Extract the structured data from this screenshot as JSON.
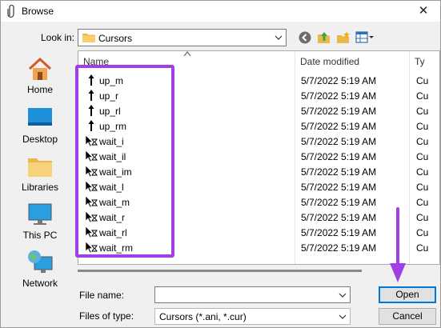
{
  "window": {
    "title": "Browse",
    "close_glyph": "✕"
  },
  "look_in": {
    "label": "Look in:",
    "value": "Cursors"
  },
  "places": [
    {
      "label": "Home",
      "icon": "home-icon"
    },
    {
      "label": "Desktop",
      "icon": "desktop-icon"
    },
    {
      "label": "Libraries",
      "icon": "libraries-folder-icon"
    },
    {
      "label": "This PC",
      "icon": "monitor-icon"
    },
    {
      "label": "Network",
      "icon": "network-icon"
    }
  ],
  "columns": {
    "name": "Name",
    "date": "Date modified",
    "type": "Ty"
  },
  "files": [
    {
      "name": "up_m",
      "date": "5/7/2022 5:19 AM",
      "type": "Cu",
      "icon": "up-arrow-cursor-icon"
    },
    {
      "name": "up_r",
      "date": "5/7/2022 5:19 AM",
      "type": "Cu",
      "icon": "up-arrow-cursor-icon"
    },
    {
      "name": "up_rl",
      "date": "5/7/2022 5:19 AM",
      "type": "Cu",
      "icon": "up-arrow-cursor-icon"
    },
    {
      "name": "up_rm",
      "date": "5/7/2022 5:19 AM",
      "type": "Cu",
      "icon": "up-arrow-cursor-icon"
    },
    {
      "name": "wait_i",
      "date": "5/7/2022 5:19 AM",
      "type": "Cu",
      "icon": "busy-pointer-cursor-icon"
    },
    {
      "name": "wait_il",
      "date": "5/7/2022 5:19 AM",
      "type": "Cu",
      "icon": "busy-pointer-cursor-icon"
    },
    {
      "name": "wait_im",
      "date": "5/7/2022 5:19 AM",
      "type": "Cu",
      "icon": "busy-pointer-cursor-icon"
    },
    {
      "name": "wait_l",
      "date": "5/7/2022 5:19 AM",
      "type": "Cu",
      "icon": "busy-pointer-cursor-icon"
    },
    {
      "name": "wait_m",
      "date": "5/7/2022 5:19 AM",
      "type": "Cu",
      "icon": "busy-pointer-cursor-icon"
    },
    {
      "name": "wait_r",
      "date": "5/7/2022 5:19 AM",
      "type": "Cu",
      "icon": "busy-pointer-cursor-icon"
    },
    {
      "name": "wait_rl",
      "date": "5/7/2022 5:19 AM",
      "type": "Cu",
      "icon": "busy-pointer-cursor-icon"
    },
    {
      "name": "wait_rm",
      "date": "5/7/2022 5:19 AM",
      "type": "Cu",
      "icon": "busy-pointer-cursor-icon"
    }
  ],
  "file_name": {
    "label": "File name:",
    "value": ""
  },
  "file_type": {
    "label": "Files of type:",
    "value": "Cursors (*.ani, *.cur)"
  },
  "buttons": {
    "open": "Open",
    "cancel": "Cancel"
  },
  "annotation": {
    "highlight_color": "#a23ee6",
    "arrow_color": "#a23ee6"
  }
}
